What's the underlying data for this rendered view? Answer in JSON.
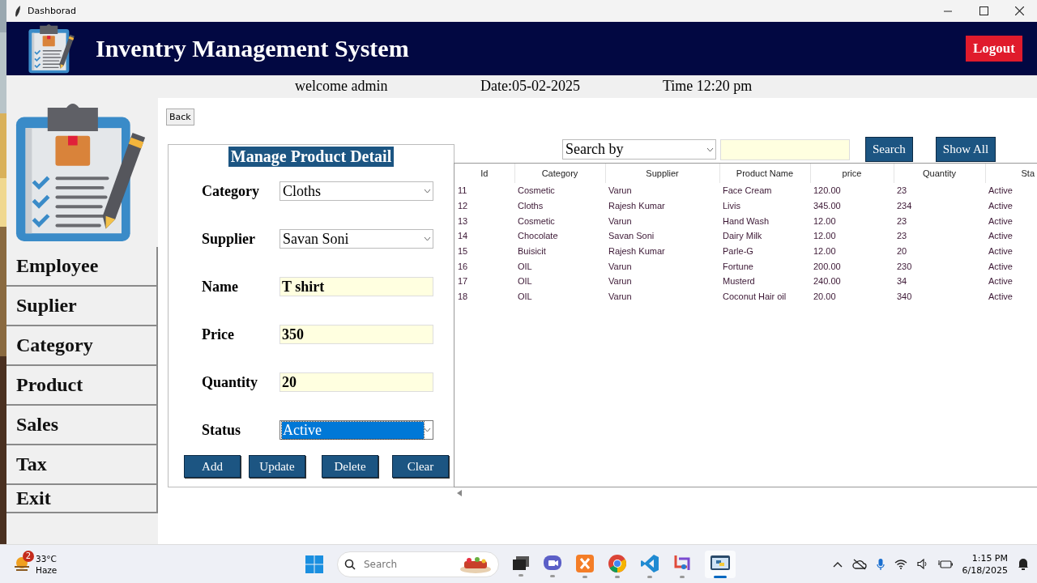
{
  "window": {
    "title": "Dashborad"
  },
  "header": {
    "title": "Inventry Management System",
    "logout": "Logout"
  },
  "info_bar": {
    "welcome": "welcome admin",
    "date": "Date:05-02-2025",
    "time": "Time 12:20 pm"
  },
  "sidebar": {
    "items": [
      "Employee",
      "Suplier",
      "Category",
      "Product",
      "Sales",
      "Tax",
      "Exit"
    ]
  },
  "back_button": "Back",
  "form": {
    "title": "Manage Product Detail",
    "fields": [
      {
        "label": "Category",
        "kind": "select",
        "value": "Cloths",
        "focused": false
      },
      {
        "label": "Supplier",
        "kind": "select",
        "value": "Savan Soni",
        "focused": false
      },
      {
        "label": "Name",
        "kind": "entry",
        "value": "T shirt"
      },
      {
        "label": "Price",
        "kind": "entry",
        "value": "350"
      },
      {
        "label": "Quantity",
        "kind": "entry",
        "value": "20"
      },
      {
        "label": "Status",
        "kind": "select",
        "value": "Active",
        "focused": true
      }
    ],
    "buttons": [
      "Add",
      "Update",
      "Delete",
      "Clear"
    ]
  },
  "search": {
    "by": "Search by",
    "button": "Search",
    "show_all": "Show All"
  },
  "table": {
    "columns": [
      "Id",
      "Category",
      "Supplier",
      "Product Name",
      "price",
      "Quantity",
      "Sta"
    ],
    "rows": [
      [
        "11",
        "Cosmetic",
        "Varun",
        "Face Cream",
        "120.00",
        "23",
        "Active"
      ],
      [
        "12",
        "Cloths",
        "Rajesh Kumar",
        "Livis",
        "345.00",
        "234",
        "Active"
      ],
      [
        "13",
        "Cosmetic",
        "Varun",
        "Hand Wash",
        "12.00",
        "23",
        "Active"
      ],
      [
        "14",
        "Chocolate",
        "Savan Soni",
        "Dairy Milk",
        "12.00",
        "23",
        "Active"
      ],
      [
        "15",
        "Buisicit",
        "Rajesh Kumar",
        "Parle-G",
        "12.00",
        "20",
        "Active"
      ],
      [
        "16",
        "OIL",
        "Varun",
        "Fortune",
        "200.00",
        "230",
        "Active"
      ],
      [
        "17",
        "OIL",
        "Varun",
        "Musterd",
        "240.00",
        "34",
        "Active"
      ],
      [
        "18",
        "OIL",
        "Varun",
        "Coconut Hair oil",
        "20.00",
        "340",
        "Active"
      ]
    ]
  },
  "taskbar": {
    "weather": {
      "temperature": "33°C",
      "condition": "Haze",
      "badge": "2"
    },
    "search": {
      "placeholder": "Search"
    },
    "apps": [
      {
        "kind": "taskview",
        "active": false
      },
      {
        "kind": "chat",
        "active": false
      },
      {
        "kind": "xampp",
        "active": false
      },
      {
        "kind": "chrome",
        "active": false
      },
      {
        "kind": "code",
        "active": false
      },
      {
        "kind": "snip",
        "active": false
      },
      {
        "kind": "python",
        "active": true
      }
    ],
    "time": "1:15 PM",
    "date": "6/18/2025"
  }
}
